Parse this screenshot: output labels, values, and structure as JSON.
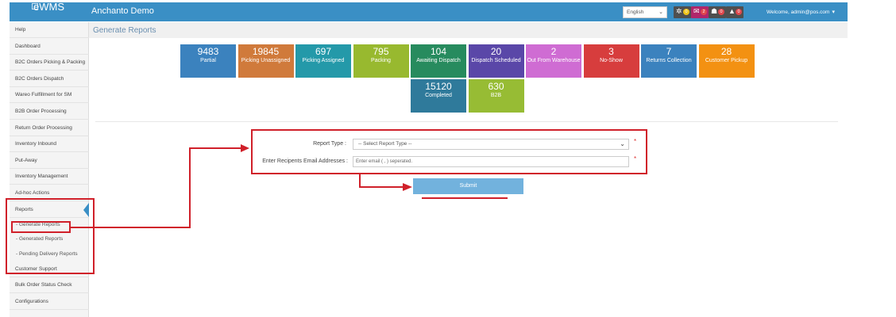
{
  "app": {
    "logo_text": "eWMS",
    "title": "Anchanto Demo"
  },
  "header": {
    "language": "English",
    "icons": [
      {
        "name": "spinner-icon",
        "bg": "#4f4f4f",
        "badge": "0",
        "badge_color": "#f0c419"
      },
      {
        "name": "envelope-icon",
        "bg": "#b0266b",
        "badge": "2",
        "badge_color": "#e0474c"
      },
      {
        "name": "user-icon",
        "bg": "#4f4f4f",
        "badge": "0",
        "badge_color": "#e0474c"
      },
      {
        "name": "bell-icon",
        "bg": "#4f4f4f",
        "badge": "0",
        "badge_color": "#e0474c"
      }
    ],
    "welcome": "Welcome, admin@pos.com"
  },
  "sidebar": {
    "items": [
      {
        "label": "Help"
      },
      {
        "label": "Dashboard"
      },
      {
        "label": "B2C Orders Picking & Packing"
      },
      {
        "label": "B2C Orders Dispatch"
      },
      {
        "label": "Wareo Fulfillment for SM"
      },
      {
        "label": "B2B Order Processing"
      },
      {
        "label": "Return Order Processing"
      },
      {
        "label": "Inventory Inbound"
      },
      {
        "label": "Put-Away"
      },
      {
        "label": "Inventory Management"
      },
      {
        "label": "Ad-hoc Actions"
      },
      {
        "label": "Reports"
      }
    ],
    "subitems": [
      {
        "label": "- Generate Reports"
      },
      {
        "label": "- Generated Reports"
      },
      {
        "label": "- Pending Delivery Reports"
      }
    ],
    "bottom_items": [
      {
        "label": "Customer Support"
      },
      {
        "label": "Bulk Order Status Check"
      },
      {
        "label": "Configurations"
      }
    ]
  },
  "page": {
    "title": "Generate Reports"
  },
  "tiles": [
    {
      "num": "9483",
      "label": "Partial",
      "color": "#3b82be"
    },
    {
      "num": "19845",
      "label": "Picking Unassigned",
      "color": "#d07a3b"
    },
    {
      "num": "697",
      "label": "Picking Assigned",
      "color": "#2499a9"
    },
    {
      "num": "795",
      "label": "Packing",
      "color": "#98b92f"
    },
    {
      "num": "104",
      "label": "Awaiting Dispatch",
      "color": "#278b5e"
    },
    {
      "num": "20",
      "label": "Dispatch Scheduled",
      "color": "#5a47a8"
    },
    {
      "num": "2",
      "label": "Out From Warehouse",
      "color": "#cf6cd3"
    },
    {
      "num": "3",
      "label": "No-Show",
      "color": "#d73d3d"
    },
    {
      "num": "7",
      "label": "Returns Collection",
      "color": "#3b82be"
    },
    {
      "num": "28",
      "label": "Customer Pickup",
      "color": "#f39112"
    },
    {
      "num": "15120",
      "label": "Completed",
      "color": "#2f7a9b"
    },
    {
      "num": "630",
      "label": "B2B",
      "color": "#97bc34"
    }
  ],
  "form": {
    "report_type_label": "Report Type :",
    "report_type_value": "-- Select Report Type --",
    "email_label": "Enter Recipents Email Addresses :",
    "email_placeholder": "Enter email ( , ) seperated.",
    "required_mark": "*",
    "submit_label": "Submit"
  }
}
